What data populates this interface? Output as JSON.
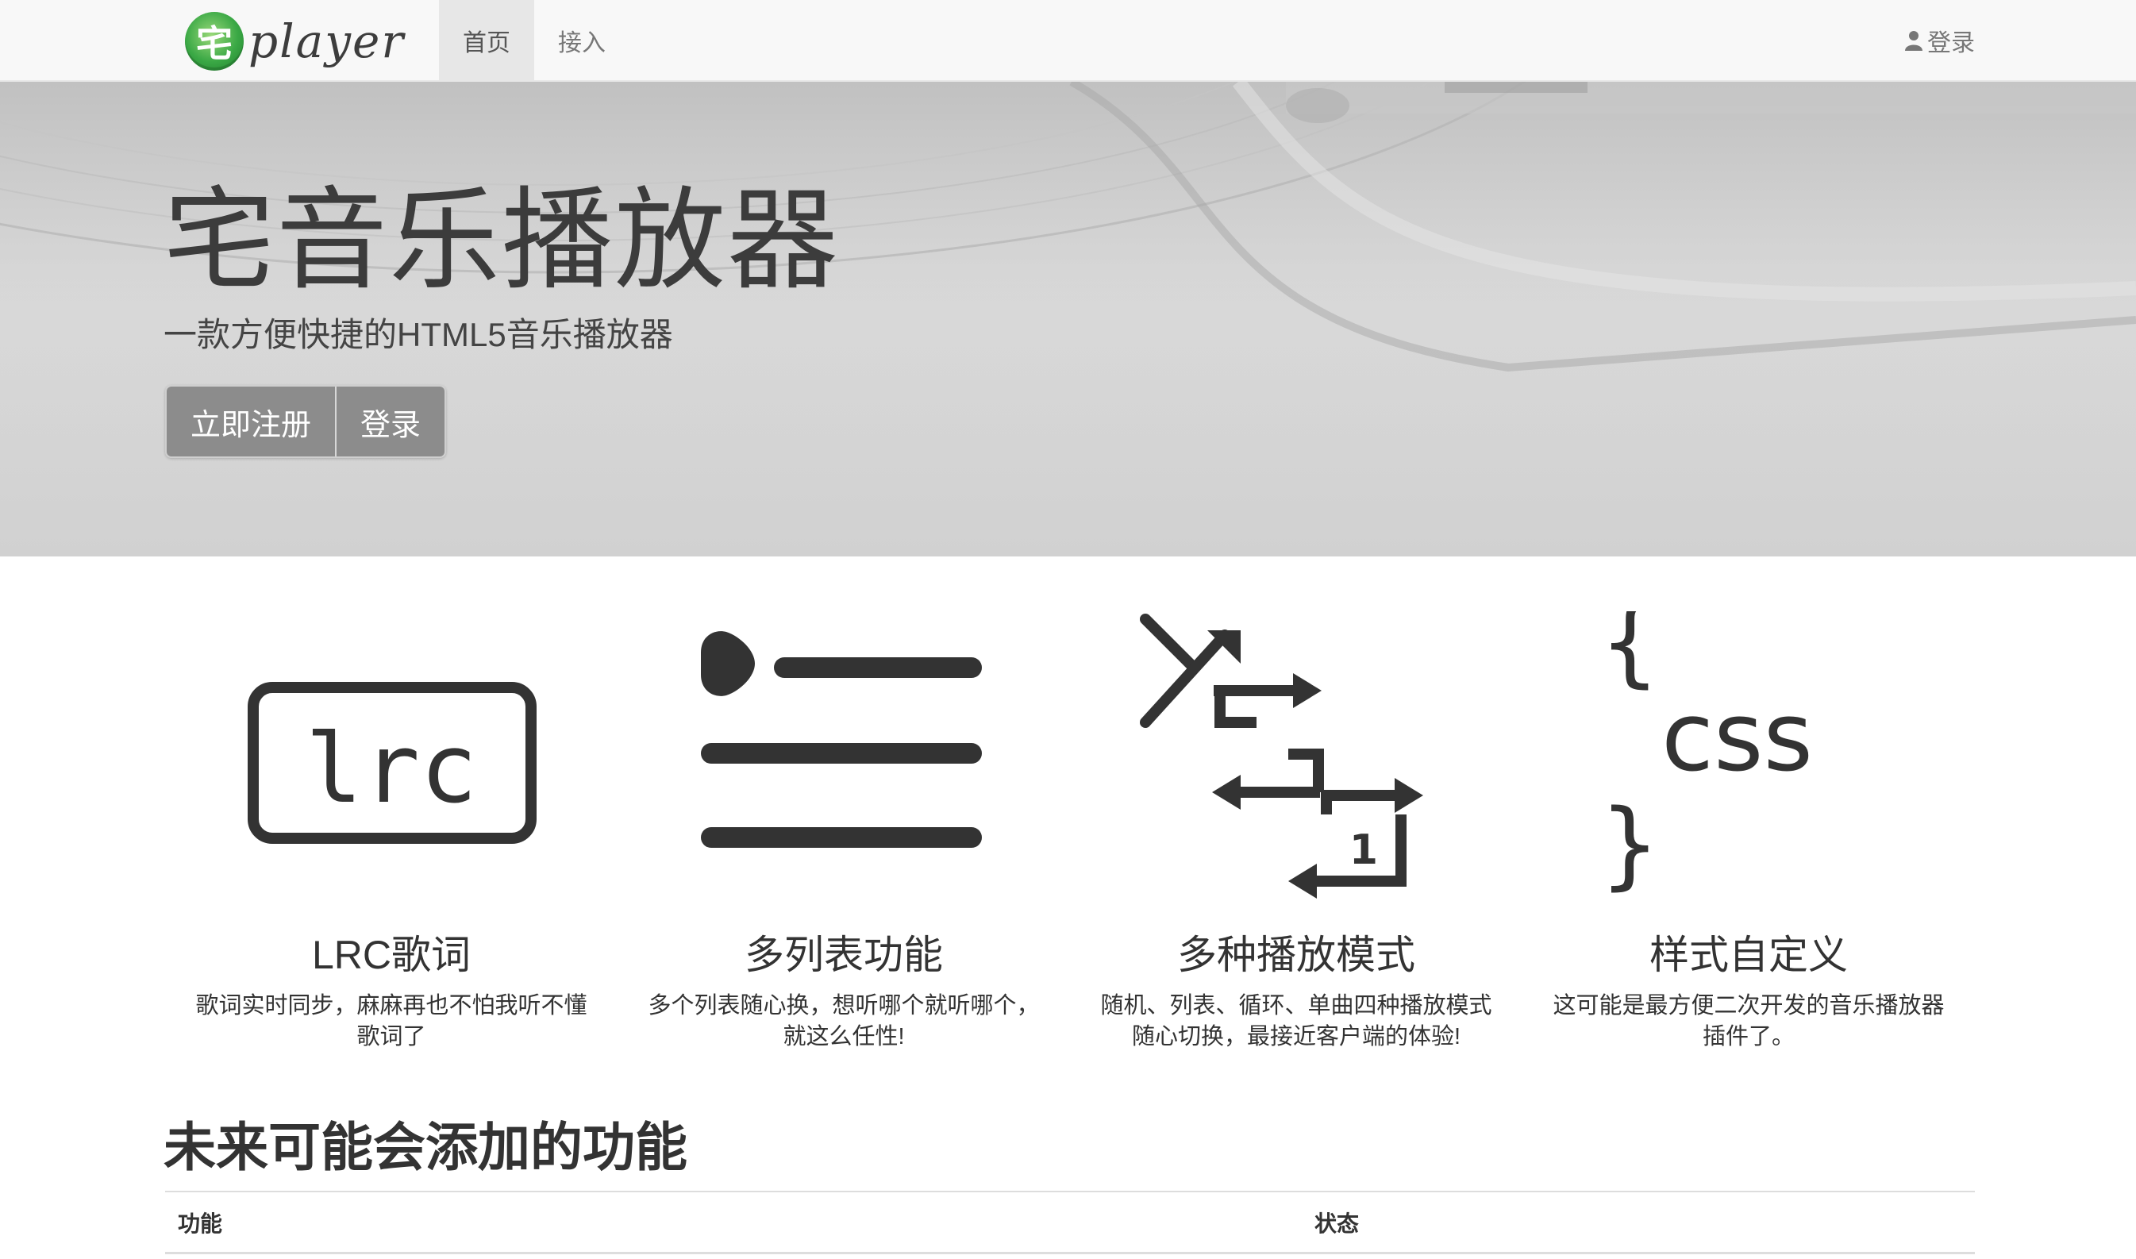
{
  "navbar": {
    "brand_text": "player",
    "brand_glyph": "宅",
    "nav_items": [
      {
        "label": "首页",
        "active": true
      },
      {
        "label": "接入",
        "active": false
      }
    ],
    "login_label": "登录"
  },
  "hero": {
    "title": "宅音乐播放器",
    "subtitle": "一款方便快捷的HTML5音乐播放器",
    "register_button": "立即注册",
    "login_button": "登录"
  },
  "features": [
    {
      "icon": "lrc-icon",
      "title": "LRC歌词",
      "desc": "歌词实时同步，麻麻再也不怕我听不懂歌词了"
    },
    {
      "icon": "playlist-icon",
      "title": "多列表功能",
      "desc": "多个列表随心换，想听哪个就听哪个，就这么任性!"
    },
    {
      "icon": "play-mode-icon",
      "title": "多种播放模式",
      "desc": "随机、列表、循环、单曲四种播放模式随心切换，最接近客户端的体验!"
    },
    {
      "icon": "css-icon",
      "title": "样式自定义",
      "desc": "这可能是最方便二次开发的音乐播放器插件了。"
    }
  ],
  "future": {
    "title": "未来可能会添加的功能",
    "columns": [
      "功能",
      "状态"
    ]
  },
  "colors": {
    "icon_dark": "#333333",
    "brand_green": "#3aa845",
    "button_gray": "#8c8c8c",
    "navbar_bg": "#f8f8f8"
  }
}
